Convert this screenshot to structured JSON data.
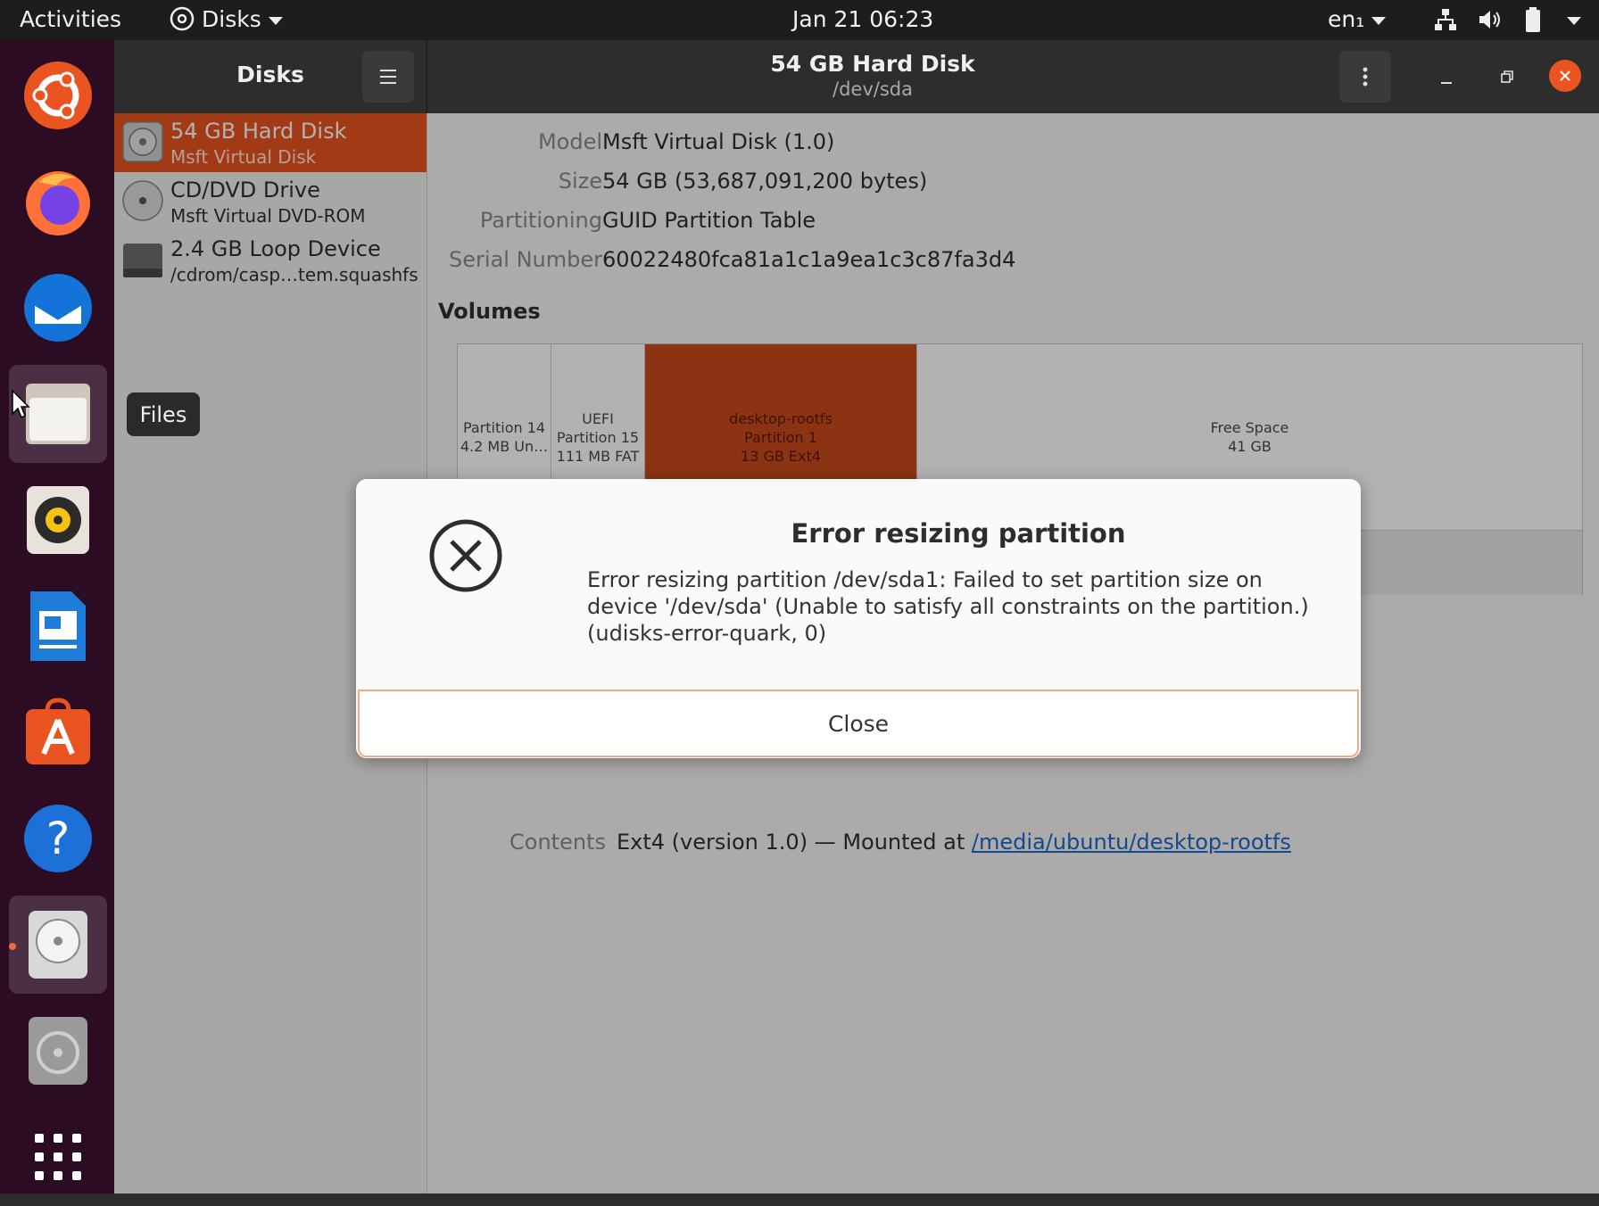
{
  "topbar": {
    "activities": "Activities",
    "app_menu": "Disks",
    "clock": "Jan 21  06:23",
    "input_source": "en₁"
  },
  "dock": {
    "items": [
      "ubuntu-software-logo",
      "firefox",
      "thunderbird",
      "files",
      "rhythmbox",
      "libreoffice-writer",
      "ubuntu-software",
      "help",
      "disks",
      "disk-image",
      "show-apps"
    ],
    "tooltip": "Files"
  },
  "window": {
    "sidebar_title": "Disks",
    "title": "54 GB Hard Disk",
    "subtitle": "/dev/sda"
  },
  "drives": [
    {
      "title": "54 GB Hard Disk",
      "sub": "Msft Virtual Disk"
    },
    {
      "title": "CD/DVD Drive",
      "sub": "Msft Virtual DVD-ROM"
    },
    {
      "title": "2.4 GB Loop Device",
      "sub": "/cdrom/casp…tem.squashfs"
    }
  ],
  "properties": {
    "model_label": "Model",
    "model": "Msft Virtual Disk (1.0)",
    "size_label": "Size",
    "size": "54 GB (53,687,091,200 bytes)",
    "partitioning_label": "Partitioning",
    "partitioning": "GUID Partition Table",
    "serial_label": "Serial Number",
    "serial": "60022480fca81a1c1a9ea1c3c87fa3d4"
  },
  "volumes": {
    "title": "Volumes",
    "segments": [
      {
        "line1": "Partition 14",
        "line2": "4.2 MB Un…",
        "line3": ""
      },
      {
        "line1": "UEFI",
        "line2": "Partition 15",
        "line3": "111 MB FAT"
      },
      {
        "line1": "desktop-rootfs",
        "line2": "Partition 1",
        "line3": "13 GB Ext4"
      },
      {
        "line1": "Free Space",
        "line2": "41 GB",
        "line3": ""
      }
    ],
    "contents_label": "Contents",
    "contents_text": "Ext4 (version 1.0) — Mounted at ",
    "contents_link": "/media/ubuntu/desktop-rootfs"
  },
  "dialog": {
    "title": "Error resizing partition",
    "message_line1": "Error resizing partition /dev/sda1: Failed to set partition size on",
    "message_line2": "device '/dev/sda' (Unable to satisfy all constraints on the partition.)",
    "message_line3": "(udisks-error-quark, 0)",
    "close_label": "Close"
  },
  "colors": {
    "accent": "#e95420",
    "dock": "#2b0c22",
    "topbar": "#1d1d1d"
  }
}
